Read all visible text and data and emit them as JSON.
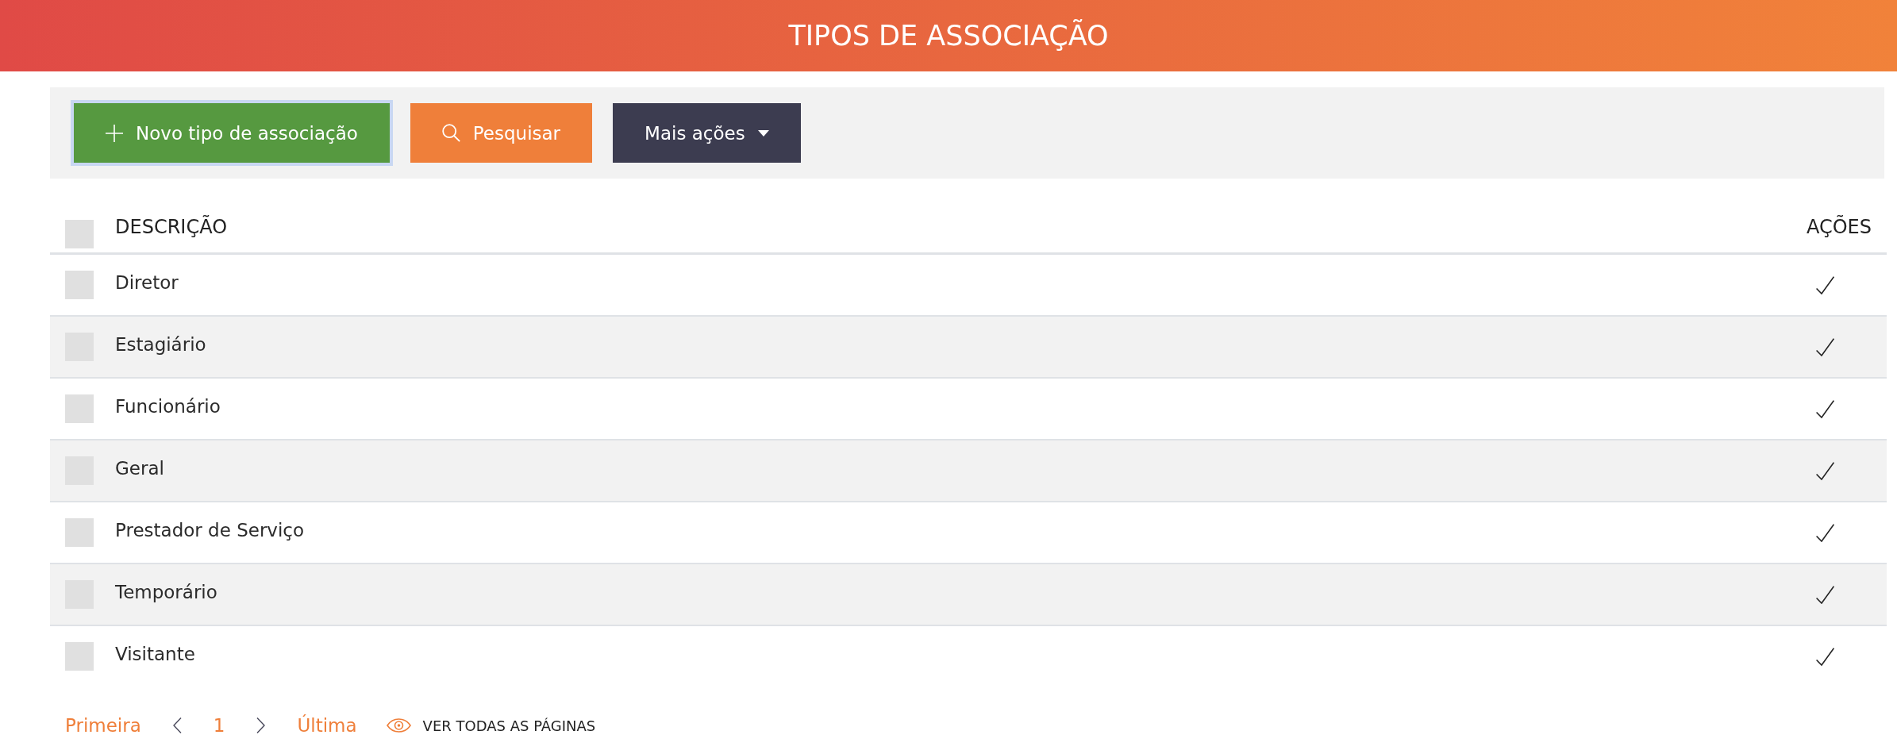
{
  "header": {
    "title": "TIPOS DE ASSOCIAÇÃO"
  },
  "toolbar": {
    "buttons": [
      {
        "kind": "add",
        "label": "Novo tipo de associação",
        "focused": true
      },
      {
        "kind": "search",
        "label": "Pesquisar",
        "focused": false
      },
      {
        "kind": "menu",
        "label": "Mais ações",
        "focused": false
      }
    ]
  },
  "table": {
    "select_all": {
      "checked": false
    },
    "columns": [
      "DESCRIÇÃO",
      "AÇÕES"
    ],
    "rows": [
      {
        "description": "Diretor",
        "checked": false
      },
      {
        "description": "Estagiário",
        "checked": false
      },
      {
        "description": "Funcionário",
        "checked": false
      },
      {
        "description": "Geral",
        "checked": false
      },
      {
        "description": "Prestador de Serviço",
        "checked": false
      },
      {
        "description": "Temporário",
        "checked": false
      },
      {
        "description": "Visitante",
        "checked": false
      }
    ]
  },
  "pagination": {
    "first": "Primeira",
    "page": "1",
    "last": "Última",
    "view_all": "VER TODAS AS PÁGINAS"
  }
}
